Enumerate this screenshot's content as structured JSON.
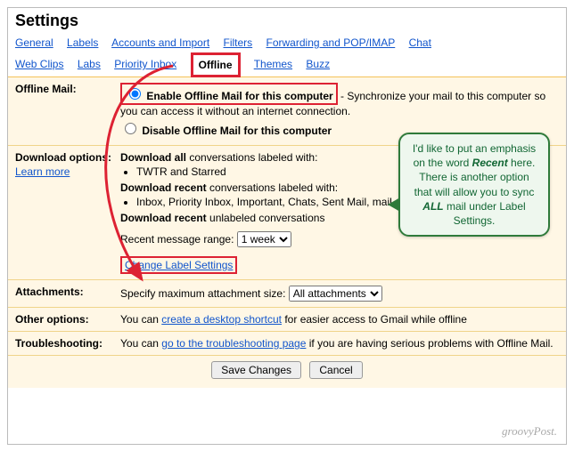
{
  "title": "Settings",
  "tabs": {
    "general": "General",
    "labels": "Labels",
    "accounts": "Accounts and Import",
    "filters": "Filters",
    "forwarding": "Forwarding and POP/IMAP",
    "chat": "Chat",
    "webclips": "Web Clips",
    "labs": "Labs",
    "priority": "Priority Inbox",
    "offline": "Offline",
    "themes": "Themes",
    "buzz": "Buzz"
  },
  "offline_mail": {
    "heading": "Offline Mail:",
    "enable_label": "Enable Offline Mail for this computer",
    "enable_desc": " - Synchronize your mail to this computer so you can access it without an internet connection.",
    "disable_label": "Disable Offline Mail for this computer"
  },
  "download": {
    "heading": "Download options:",
    "learn_more": "Learn more",
    "all_lead": "Download all",
    "all_rest": " conversations labeled with:",
    "all_items": "TWTR and Starred",
    "recent_lead": "Download recent",
    "recent_rest": " conversations labeled with:",
    "recent_items": "Inbox, Priority Inbox, Important, Chats, Sent Mail, mail and SU.PR",
    "recent_unlabeled_lead": "Download recent",
    "recent_unlabeled_rest": " unlabeled conversations",
    "range_label": "Recent message range:",
    "range_value": "1 week",
    "change_label_settings": "Change Label Settings"
  },
  "attachments": {
    "heading": "Attachments:",
    "label": "Specify maximum attachment size:",
    "value": "All attachments"
  },
  "other": {
    "heading": "Other options:",
    "pre": "You can ",
    "link": "create a desktop shortcut",
    "post": " for easier access to Gmail while offline"
  },
  "troubleshoot": {
    "heading": "Troubleshooting:",
    "pre": "You can ",
    "link": "go to the troubleshooting page",
    "post": " if you are having serious problems with Offline Mail."
  },
  "footer": {
    "save": "Save Changes",
    "cancel": "Cancel"
  },
  "callout": {
    "text1": "I'd like to put an emphasis on the word ",
    "em": "Recent",
    "text2": " here. There is another option that will allow you to sync ",
    "all": "ALL",
    "text3": " mail under Label Settings."
  },
  "watermark": "groovyPost."
}
